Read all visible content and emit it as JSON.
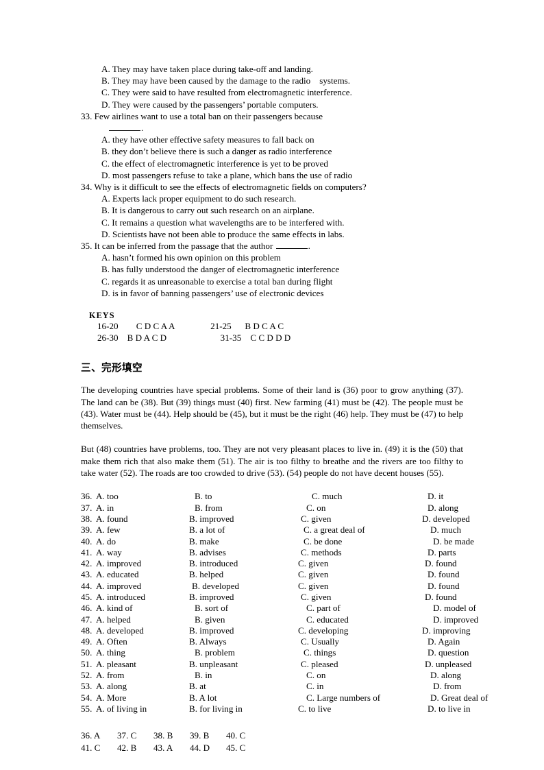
{
  "reading": {
    "q32_options": [
      "A. They may have taken place during take-off and landing.",
      "B. They may have been caused by the damage to the radio    systems.",
      "C. They were said to have resulted from electromagnetic interference.",
      "D. They were caused by the passengers’ portable computers."
    ],
    "q33": {
      "stem": "33. Few airlines want to use a total ban on their passengers because",
      "stem_tail": ".",
      "options": [
        "A. they have other effective safety measures to fall back on",
        "B. they don’t believe there is such a danger as radio interference",
        "C. the effect of electromagnetic interference is yet to be proved",
        "D. most passengers refuse to take a plane, which bans the use of radio"
      ]
    },
    "q34": {
      "stem": "34. Why is it difficult to see the effects of electromagnetic fields on computers?",
      "options": [
        "A. Experts lack proper equipment to do such research.",
        "B. It is dangerous to carry out such research on an airplane.",
        "C. It remains a question what wavelengths are to be interfered with.",
        "D. Scientists have not been able to produce the same effects in labs."
      ]
    },
    "q35": {
      "stem_lead": "35. It can be inferred from the passage that the author ",
      "stem_tail": ".",
      "options": [
        "A. hasn’t formed his own opinion on this problem",
        "B. has fully understood the danger of electromagnetic interference",
        "C. regards it as unreasonable to exercise a total ban during flight",
        "D. is in favor of banning passengers’ use of electronic devices"
      ]
    }
  },
  "keys": {
    "title": "KEYS",
    "rows": [
      "16-20        C D C A A                21-25      B D C A C",
      "26-30    B D A C D                        31-35    C C D D D"
    ]
  },
  "cloze": {
    "heading": "三、完形填空",
    "paragraph1": "The developing countries have special problems. Some of their land is (36) poor to grow anything (37). The land can be (38). But (39) things must (40) first. New farming (41) must be (42). The people must be (43). Water must be (44). Help should be (45), but it must be the right (46) help. They must be (47) to help themselves.",
    "paragraph2": "But (48) countries have problems, too. They are not very pleasant places to live in. (49) it is the (50) that make them rich that also make them (51). The air is too filthy to breathe and the rivers are too filthy to take water (52). The roads are too crowded to drive (53). (54) people do not have decent houses (55).",
    "options": [
      {
        "num": "36.",
        "a": "A. too",
        "b": "B. to",
        "c": "C. much",
        "d": "D. it",
        "ia": 0,
        "ib": 24,
        "ic": 36,
        "id": 24
      },
      {
        "num": "37.",
        "a": "A. in",
        "b": "B. from",
        "c": "C. on",
        "d": "D. along",
        "ia": 0,
        "ib": 24,
        "ic": 28,
        "id": 24
      },
      {
        "num": "38.",
        "a": "A. found",
        "b": "B. improved",
        "c": "C. given",
        "d": "D. developed",
        "ia": 0,
        "ib": 16,
        "ic": 20,
        "id": 16
      },
      {
        "num": "39.",
        "a": "A. few",
        "b": "B. a lot of",
        "c": "C. a great deal of",
        "d": "D. much",
        "ia": 0,
        "ib": 16,
        "ic": 24,
        "id": 28
      },
      {
        "num": "40.",
        "a": "A. do",
        "b": "B. make",
        "c": "C. be done",
        "d": "D. be made",
        "ia": 0,
        "ib": 16,
        "ic": 24,
        "id": 32
      },
      {
        "num": "41.",
        "a": "A. way",
        "b": "B. advises",
        "c": "C. methods",
        "d": "D. parts",
        "ia": 0,
        "ib": 16,
        "ic": 20,
        "id": 24
      },
      {
        "num": "42.",
        "a": "A. improved",
        "b": "B. introduced",
        "c": "C. given",
        "d": "D. found",
        "ia": 0,
        "ib": 16,
        "ic": 16,
        "id": 20
      },
      {
        "num": "43.",
        "a": "A. educated",
        "b": "B. helped",
        "c": "C. given",
        "d": "D. found",
        "ia": 0,
        "ib": 16,
        "ic": 16,
        "id": 24
      },
      {
        "num": "44.",
        "a": "A. improved",
        "b": "B. developed",
        "c": "C. given",
        "d": "D. found",
        "ia": 0,
        "ib": 20,
        "ic": 16,
        "id": 24
      },
      {
        "num": "45.",
        "a": "A. introduced",
        "b": "B. improved",
        "c": "C. given",
        "d": "D. found",
        "ia": 0,
        "ib": 16,
        "ic": 20,
        "id": 20
      },
      {
        "num": "46.",
        "a": "A. kind of",
        "b": "B. sort of",
        "c": "C. part of",
        "d": "D. model of",
        "ia": 0,
        "ib": 24,
        "ic": 28,
        "id": 32
      },
      {
        "num": "47.",
        "a": "A. helped",
        "b": "B. given",
        "c": "C. educated",
        "d": "D. improved",
        "ia": 0,
        "ib": 24,
        "ic": 28,
        "id": 32
      },
      {
        "num": "48.",
        "a": "A. developed",
        "b": "B. improved",
        "c": "C. developing",
        "d": "D. improving",
        "ia": 0,
        "ib": 16,
        "ic": 16,
        "id": 16
      },
      {
        "num": "49.",
        "a": "A. Often",
        "b": "B. Always",
        "c": "C. Usually",
        "d": "D. Again",
        "ia": 0,
        "ib": 16,
        "ic": 20,
        "id": 24
      },
      {
        "num": "50.",
        "a": "A. thing",
        "b": "B. problem",
        "c": "C. things",
        "d": "D. question",
        "ia": 0,
        "ib": 24,
        "ic": 24,
        "id": 24
      },
      {
        "num": "51.",
        "a": "A. pleasant",
        "b": "B. unpleasant",
        "c": "C. pleased",
        "d": "D. unpleased",
        "ia": 0,
        "ib": 16,
        "ic": 20,
        "id": 20
      },
      {
        "num": "52.",
        "a": "A. from",
        "b": "B. in",
        "c": "C. on",
        "d": "D. along",
        "ia": 0,
        "ib": 24,
        "ic": 28,
        "id": 28
      },
      {
        "num": "53.",
        "a": "A. along",
        "b": "B. at",
        "c": "C. in",
        "d": "D. from",
        "ia": 0,
        "ib": 16,
        "ic": 28,
        "id": 32
      },
      {
        "num": "54.",
        "a": "A. More",
        "b": "B. A lot",
        "c": "C. Large numbers of",
        "d": "D. Great deal of",
        "ia": 0,
        "ib": 16,
        "ic": 28,
        "id": 28
      },
      {
        "num": "55.",
        "a": "A. of living in",
        "b": "B. for living in",
        "c": "C. to live",
        "d": "D. to live in",
        "ia": 0,
        "ib": 16,
        "ic": 16,
        "id": 24
      }
    ],
    "answers": [
      [
        "36. A",
        "37. C",
        "38. B",
        "39. B",
        "40. C"
      ],
      [
        "41. C",
        "42. B",
        "43. A",
        "44. D",
        "45. C"
      ]
    ]
  }
}
